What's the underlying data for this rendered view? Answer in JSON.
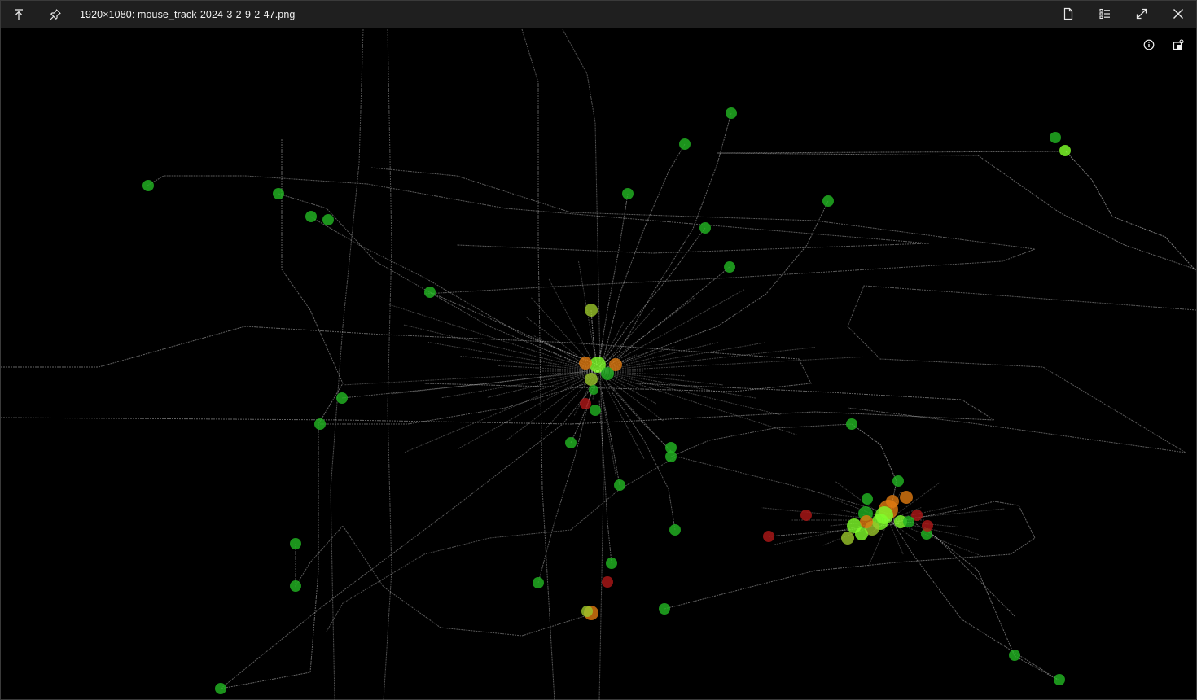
{
  "window": {
    "title": "1920×1080: mouse_track-2024-3-2-9-2-47.png",
    "background": "#000000",
    "titlebar_color": "#1f1f1f"
  },
  "toolbar": {
    "left": [
      {
        "icon": "move-to-top-icon",
        "label": "Keep on top"
      },
      {
        "icon": "pin-icon",
        "label": "Pin"
      }
    ],
    "right": [
      {
        "icon": "document-icon",
        "label": "Document"
      },
      {
        "icon": "list-icon",
        "label": "List"
      },
      {
        "icon": "expand-icon",
        "label": "Expand"
      },
      {
        "icon": "close-icon",
        "label": "Close"
      }
    ]
  },
  "overlay": [
    {
      "icon": "info-icon"
    },
    {
      "icon": "window-settings-icon"
    }
  ],
  "track": {
    "line_color": "#c8c8c8",
    "click_colors": {
      "green": "#22b322",
      "lime": "#7fff2a",
      "red": "#b01818",
      "orange": "#e07a10",
      "yellowgreen": "#9ac52a"
    }
  }
}
